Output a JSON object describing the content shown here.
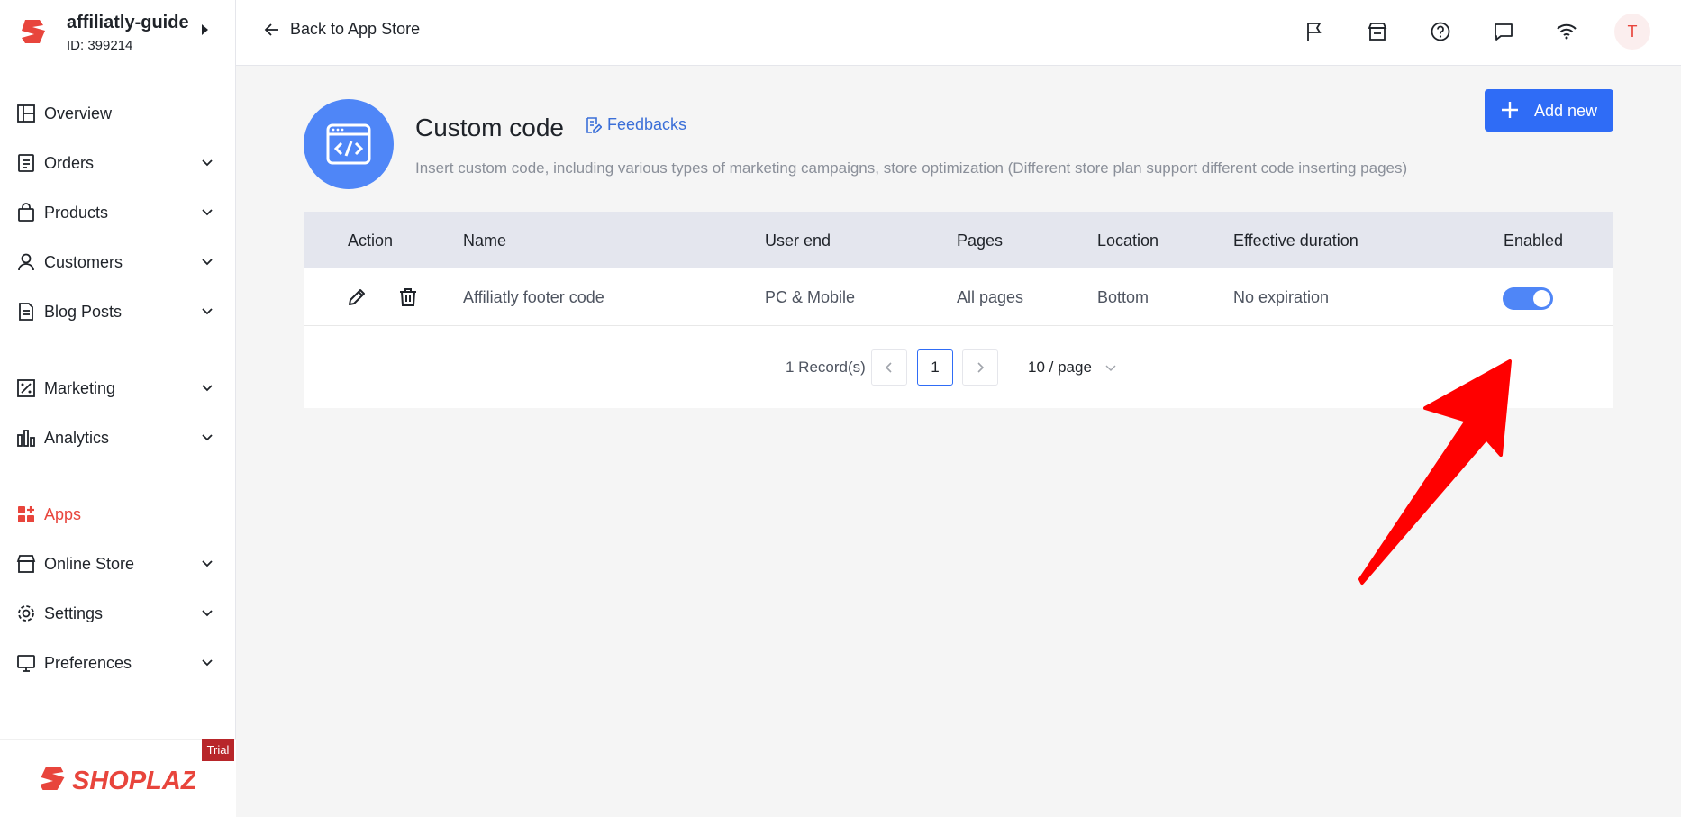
{
  "store": {
    "name": "affiliatly-guide",
    "id": "ID: 399214"
  },
  "sidebar": {
    "items": [
      {
        "label": "Overview",
        "icon": "overview-icon"
      },
      {
        "label": "Orders",
        "icon": "orders-icon"
      },
      {
        "label": "Products",
        "icon": "products-icon"
      },
      {
        "label": "Customers",
        "icon": "customers-icon"
      },
      {
        "label": "Blog Posts",
        "icon": "blog-posts-icon"
      },
      {
        "label": "Marketing",
        "icon": "marketing-icon"
      },
      {
        "label": "Analytics",
        "icon": "analytics-icon"
      },
      {
        "label": "Apps",
        "icon": "apps-icon"
      },
      {
        "label": "Online Store",
        "icon": "online-store-icon"
      },
      {
        "label": "Settings",
        "icon": "settings-icon"
      },
      {
        "label": "Preferences",
        "icon": "preferences-icon"
      }
    ],
    "active": "Apps",
    "trial_badge": "Trial",
    "brand": "SHOPLAZZA"
  },
  "header": {
    "back_label": "Back to App Store",
    "icons": [
      "flag-icon",
      "store-icon",
      "help-icon",
      "chat-icon",
      "wifi-icon"
    ],
    "avatar_initial": "T"
  },
  "app": {
    "title": "Custom code",
    "feedback_label": "Feedbacks",
    "description": "Insert custom code, including various types of marketing campaigns, store optimization (Different store plan support different code inserting pages)",
    "add_label": "Add new"
  },
  "table": {
    "columns": [
      "Action",
      "Name",
      "User end",
      "Pages",
      "Location",
      "Effective duration",
      "Enabled"
    ],
    "rows": [
      {
        "name": "Affiliatly footer code",
        "user_end": "PC & Mobile",
        "pages": "All pages",
        "location": "Bottom",
        "duration": "No expiration",
        "enabled": true
      }
    ]
  },
  "pagination": {
    "records": "1 Record(s)",
    "current_page": "1",
    "per_page": "10 / page"
  },
  "colors": {
    "accent": "#2f6cf6",
    "brand_red": "#e8453c",
    "annotation_arrow": "#ff0000"
  }
}
